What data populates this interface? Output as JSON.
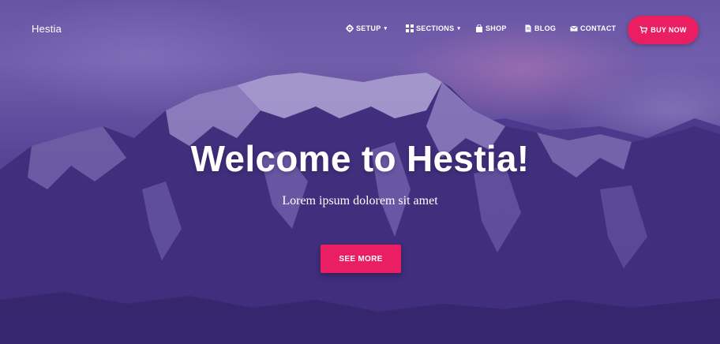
{
  "brand": {
    "name": "Hestia"
  },
  "nav": {
    "items": [
      {
        "label": "SETUP",
        "icon": "gear-icon",
        "dropdown": true
      },
      {
        "label": "SECTIONS",
        "icon": "grid-icon",
        "dropdown": true
      },
      {
        "label": "SHOP",
        "icon": "bag-icon",
        "dropdown": false
      },
      {
        "label": "BLOG",
        "icon": "document-icon",
        "dropdown": false
      },
      {
        "label": "CONTACT",
        "icon": "envelope-icon",
        "dropdown": false
      }
    ],
    "buy_now": {
      "label": "BUY NOW",
      "icon": "cart-icon"
    }
  },
  "hero": {
    "title": "Welcome to Hestia!",
    "subtitle": "Lorem ipsum dolorem sit amet",
    "cta_label": "SEE MORE"
  },
  "colors": {
    "accent": "#e91e63",
    "overlay": "#5a4a9c",
    "text": "#ffffff"
  }
}
